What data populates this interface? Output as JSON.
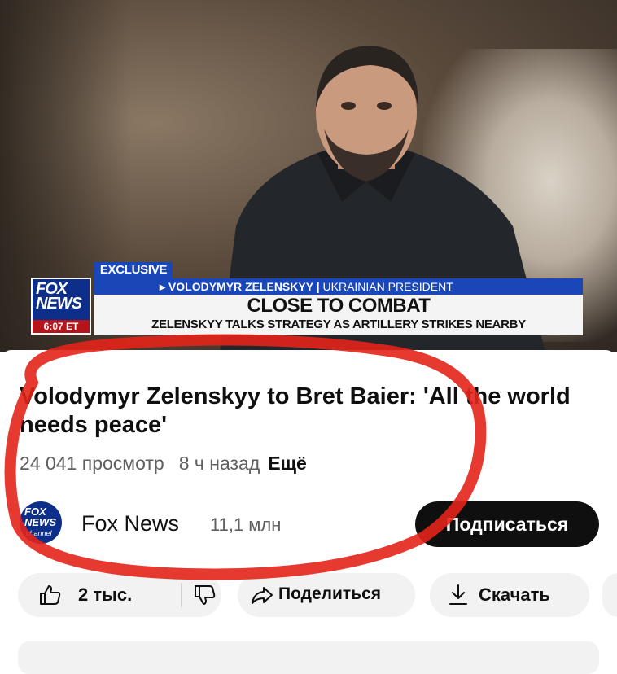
{
  "video": {
    "exclusive_label": "EXCLUSIVE",
    "name_line": "VOLODYMYR ZELENSKYY",
    "role_line": "UKRAINIAN PRESIDENT",
    "headline": "CLOSE TO COMBAT",
    "subheadline": "ZELENSKYY TALKS STRATEGY AS ARTILLERY STRIKES NEARBY",
    "logo_line1": "FOX",
    "logo_line2": "NEWS",
    "logo_time": "6:07 ET"
  },
  "details": {
    "title": "Volodymyr Zelenskyy to Bret Baier: 'All the world needs peace'",
    "views": "24 041 просмотр",
    "time_ago": "8 ч назад",
    "more_label": "Ещё"
  },
  "channel": {
    "avatar_line1": "FOX",
    "avatar_line2": "NEWS",
    "avatar_line3": "channel",
    "name": "Fox News",
    "subscribers": "11,1 млн",
    "subscribe_label": "Подписаться"
  },
  "actions": {
    "likes": "2 тыс.",
    "share_label": "Поделиться",
    "download_label": "Скачать"
  },
  "colors": {
    "annotation_circle": "#e3231a",
    "fox_blue": "#0d2f8a",
    "lower_third_blue": "#1a47b8",
    "fox_red": "#b3151b"
  },
  "icons": [
    "thumbs-up-icon",
    "thumbs-down-icon",
    "share-arrow-icon",
    "download-icon"
  ]
}
